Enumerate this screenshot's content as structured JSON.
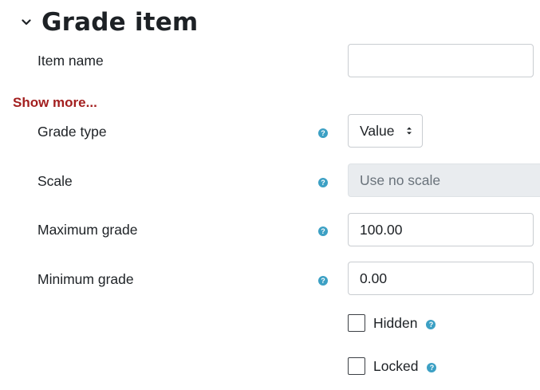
{
  "section": {
    "title": "Grade item",
    "collapse_icon": "chevron-down-icon"
  },
  "fields": {
    "item_name": {
      "label": "Item name",
      "value": ""
    },
    "show_more": "Show more...",
    "grade_type": {
      "label": "Grade type",
      "selected": "Value",
      "help_icon": "question-mark"
    },
    "scale": {
      "label": "Scale",
      "value": "Use no scale",
      "help_icon": "question-mark"
    },
    "maximum_grade": {
      "label": "Maximum grade",
      "value": "100.00",
      "help_icon": "question-mark"
    },
    "minimum_grade": {
      "label": "Minimum grade",
      "value": "0.00",
      "help_icon": "question-mark"
    },
    "hidden": {
      "label": "Hidden",
      "checked": false,
      "help_icon": "question-mark"
    },
    "locked": {
      "label": "Locked",
      "checked": false,
      "help_icon": "question-mark"
    }
  },
  "colors": {
    "link": "#a31f1f",
    "help_icon": "#3ca0c4",
    "disabled_bg": "#e9ecef",
    "input_border": "#c9cdd1"
  }
}
